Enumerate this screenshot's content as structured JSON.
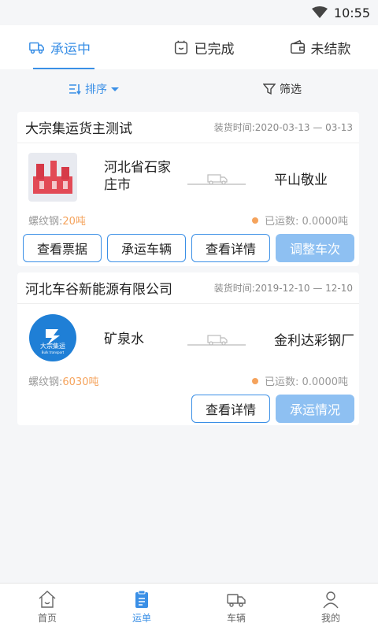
{
  "status": {
    "time": "10:55",
    "wifi_icon": "wifi-icon"
  },
  "tabs": [
    {
      "label": "承运中",
      "icon": "truck-icon",
      "active": true
    },
    {
      "label": "已完成",
      "icon": "check-bag-icon",
      "active": false
    },
    {
      "label": "未结款",
      "icon": "wallet-icon",
      "active": false
    }
  ],
  "sortbar": {
    "sort_label": "排序",
    "filter_label": "筛选"
  },
  "orders": [
    {
      "company": "大宗集运货主测试",
      "load_time": "装货时间:2020-03-13 — 03-13",
      "origin": "河北省石家庄市",
      "destination": "平山敬业",
      "goods_label": "螺纹钢:",
      "goods_qty": "20吨",
      "shipped": "已运数: 0.0000吨",
      "buttons": [
        "查看票据",
        "承运车辆",
        "查看详情",
        "调整车次"
      ]
    },
    {
      "company": "河北车谷新能源有限公司",
      "load_time": "装货时间:2019-12-10 — 12-10",
      "origin": "矿泉水",
      "destination": "金利达彩钢厂",
      "goods_label": "螺纹钢:",
      "goods_qty": "6030吨",
      "shipped": "已运数: 0.0000吨",
      "logo_title": "大宗集运",
      "logo_sub": "Bulk transport",
      "buttons": [
        "查看详情",
        "承运情况"
      ]
    }
  ],
  "bottom_nav": [
    {
      "label": "首页",
      "icon": "home-icon",
      "active": false
    },
    {
      "label": "运单",
      "icon": "waybill-icon",
      "active": true
    },
    {
      "label": "车辆",
      "icon": "truck-icon",
      "active": false
    },
    {
      "label": "我的",
      "icon": "user-icon",
      "active": false
    }
  ],
  "colors": {
    "accent": "#3a8fe6",
    "accent_light": "#8ec0f2",
    "orange": "#f5a35c"
  }
}
